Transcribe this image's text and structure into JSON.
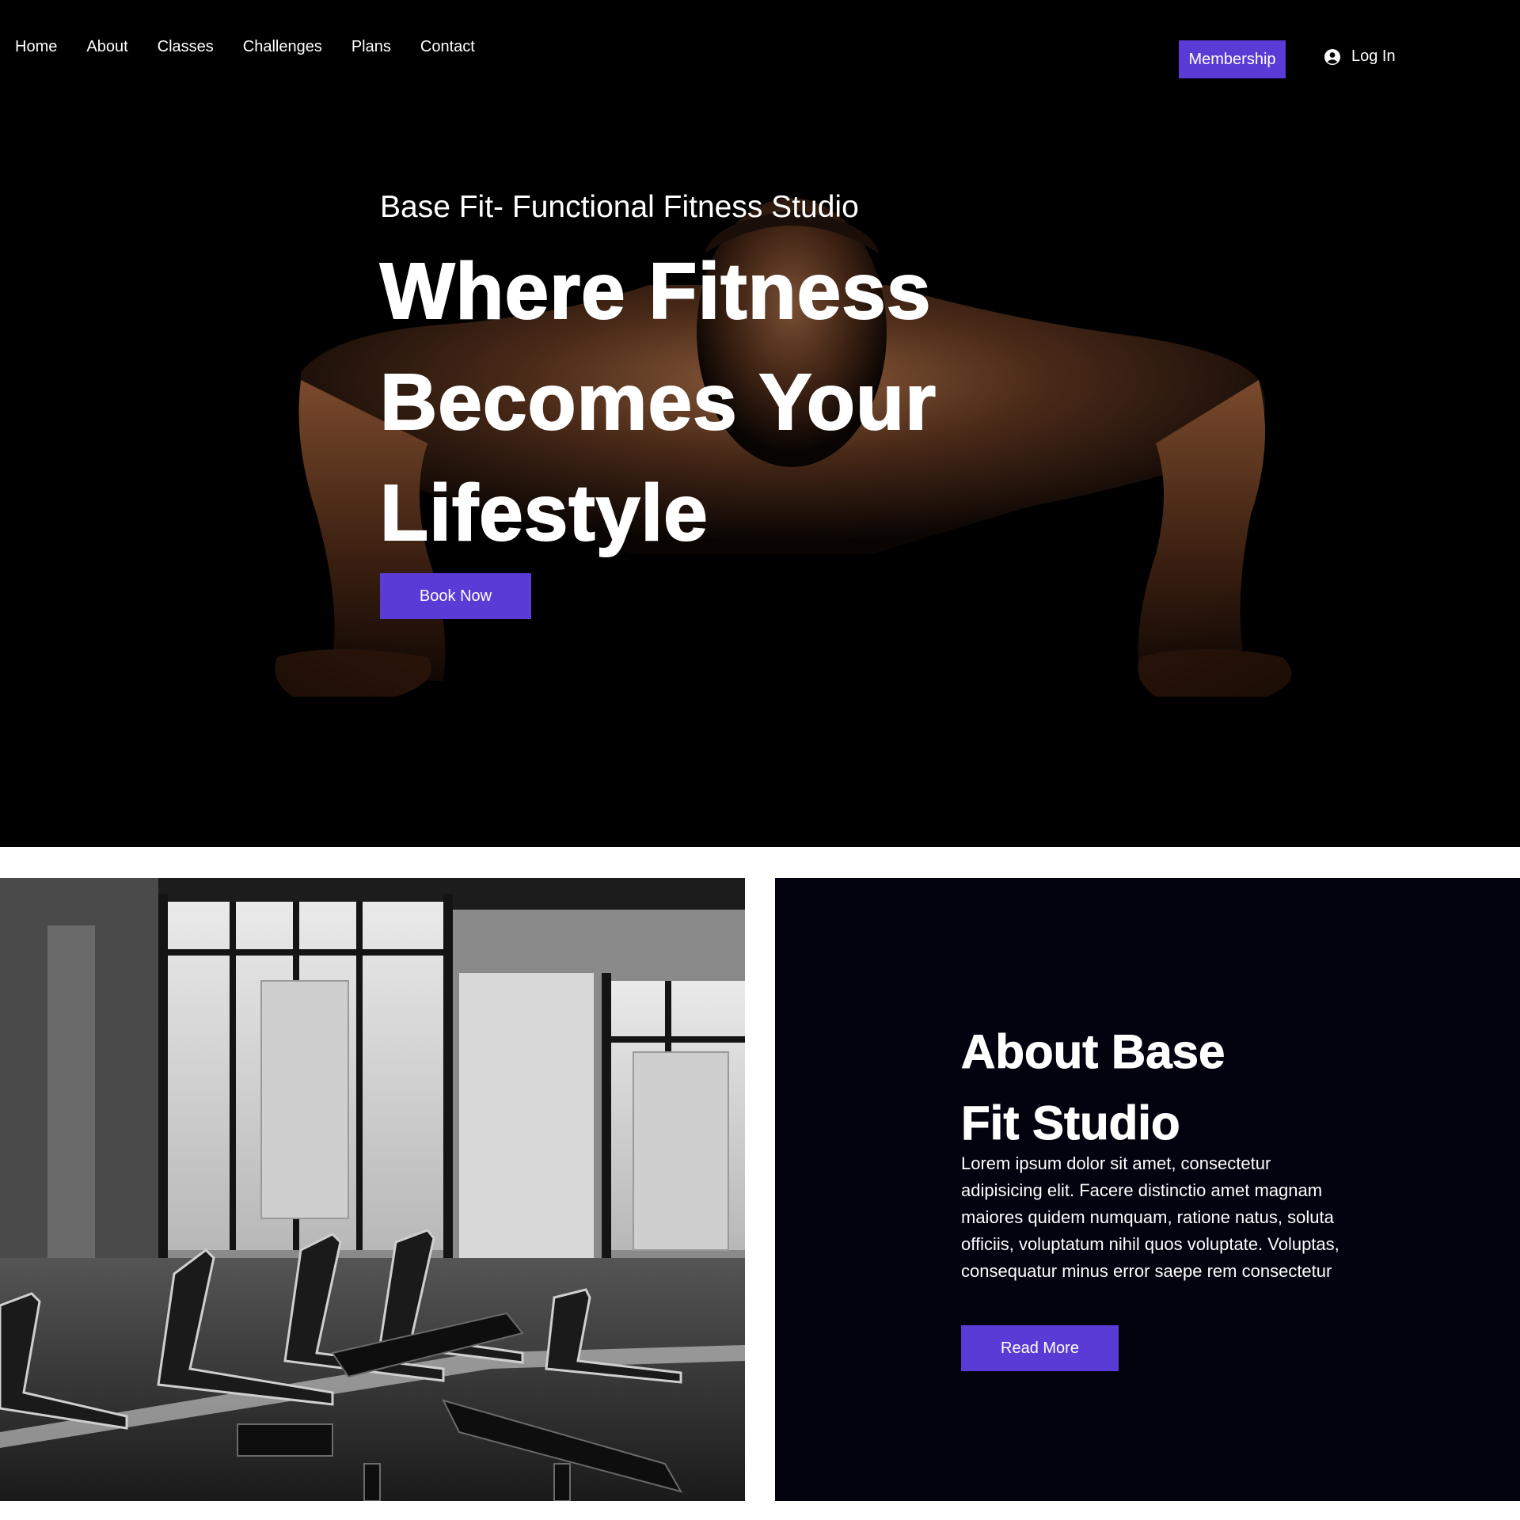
{
  "nav": {
    "links": [
      {
        "label": "Home"
      },
      {
        "label": "About"
      },
      {
        "label": "Classes"
      },
      {
        "label": "Challenges"
      },
      {
        "label": "Plans"
      },
      {
        "label": "Contact"
      }
    ],
    "membership_label": "Membership",
    "login_label": "Log In",
    "login_icon": "user-circle-icon"
  },
  "hero": {
    "subtitle": "Base Fit- Functional Fitness Studio",
    "title_lines": [
      "Where Fitness",
      "Becomes Your",
      "Lifestyle"
    ],
    "cta_label": "Book Now",
    "photo": "man-doing-pushup-photo"
  },
  "about": {
    "photo": "gym-treadmills-photo",
    "title_lines": [
      "About Base",
      "Fit Studio"
    ],
    "body": "Lorem ipsum dolor sit amet, consectetur adipisicing elit. Facere distinctio amet magnam maiores quidem numquam, ratione natus, soluta officiis, voluptatum nihil quos voluptate. Voluptas, consequatur minus error saepe rem consectetur",
    "cta_label": "Read More"
  },
  "colors": {
    "accent": "#5b3bd6",
    "hero_bg": "#000000",
    "about_bg": "#03020f",
    "text": "#ffffff"
  }
}
